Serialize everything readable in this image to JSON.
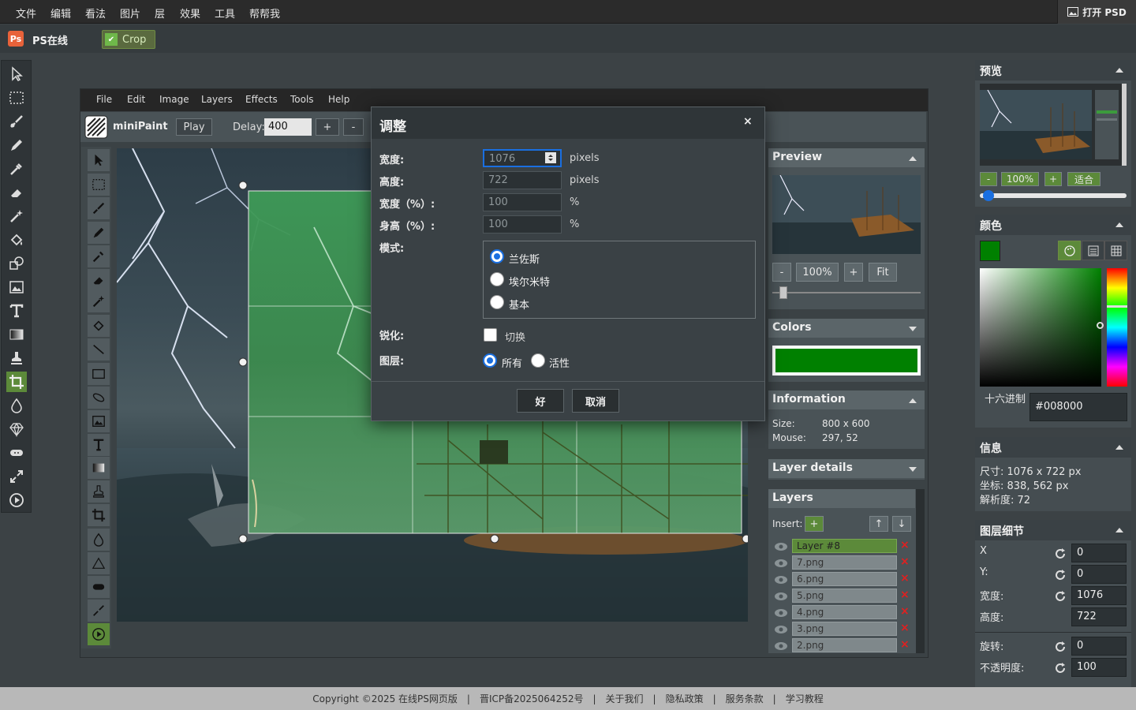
{
  "topmenu": {
    "items": [
      "文件",
      "编辑",
      "看法",
      "图片",
      "层",
      "效果",
      "工具",
      "帮帮我"
    ],
    "open_psd": "打开 PSD"
  },
  "brand": {
    "logo": "Ps",
    "name": "PS在线"
  },
  "crop_button": "Crop",
  "inner_menu": {
    "items": [
      "File",
      "Edit",
      "Image",
      "Layers",
      "Effects",
      "Tools",
      "Help"
    ]
  },
  "inner_bar": {
    "name": "miniPaint",
    "play": "Play",
    "delay_label": "Delay:",
    "delay_value": "400",
    "plus": "+",
    "minus": "-"
  },
  "inner_panels": {
    "preview": {
      "title": "Preview",
      "minus": "-",
      "zoom": "100%",
      "plus": "+",
      "fit": "Fit"
    },
    "colors": {
      "title": "Colors",
      "color": "#008000"
    },
    "information": {
      "title": "Information",
      "size_label": "Size:",
      "size": "800 x 600",
      "mouse_label": "Mouse:",
      "mouse": "297, 52"
    },
    "layer_details": {
      "title": "Layer details"
    },
    "layers": {
      "title": "Layers",
      "insert_label": "Insert:",
      "add": "+",
      "up": "↑",
      "down": "↓",
      "items": [
        "Layer #8",
        "7.png",
        "6.png",
        "5.png",
        "4.png",
        "3.png",
        "2.png"
      ]
    }
  },
  "dialog": {
    "title": "调整",
    "close": "×",
    "width_label": "宽度:",
    "width_value": "1076",
    "width_unit": "pixels",
    "height_label": "高度:",
    "height_value": "722",
    "height_unit": "pixels",
    "width_pct_label": "宽度（%）:",
    "width_pct_value": "100",
    "pct_unit": "%",
    "height_pct_label": "身高（%）:",
    "height_pct_value": "100",
    "mode_label": "模式:",
    "modes": [
      "兰佐斯",
      "埃尔米特",
      "基本"
    ],
    "sharpen_label": "锐化:",
    "sharpen_option": "切换",
    "layers_label": "图层:",
    "layer_options": [
      "所有",
      "活性"
    ],
    "ok": "好",
    "cancel": "取消"
  },
  "outer_panels": {
    "preview": {
      "title": "预览",
      "minus": "-",
      "zoom": "100%",
      "plus": "+",
      "fit": "适合"
    },
    "color": {
      "title": "颜色",
      "hex_label": "十六进制",
      "hex_value": "#008000",
      "swatch": "#008000"
    },
    "info": {
      "title": "信息",
      "size": "尺寸:  1076 x 722 px",
      "coords": "坐标:  838, 562 px",
      "resolution": "解析度:  72"
    },
    "layer_details": {
      "title": "图层细节",
      "x_label": "X",
      "x": "0",
      "y_label": "Y:",
      "y": "0",
      "w_label": "宽度:",
      "w": "1076",
      "h_label": "高度:",
      "h": "722",
      "rot_label": "旋转:",
      "rot": "0",
      "opacity_label": "不透明度:",
      "opacity": "100"
    }
  },
  "footer": {
    "items": [
      "Copyright ©2025 在线PS网页版",
      "|",
      "晋ICP备2025064252号",
      "|",
      "关于我们",
      "|",
      "隐私政策",
      "|",
      "服务条款",
      "|",
      "学习教程"
    ]
  }
}
